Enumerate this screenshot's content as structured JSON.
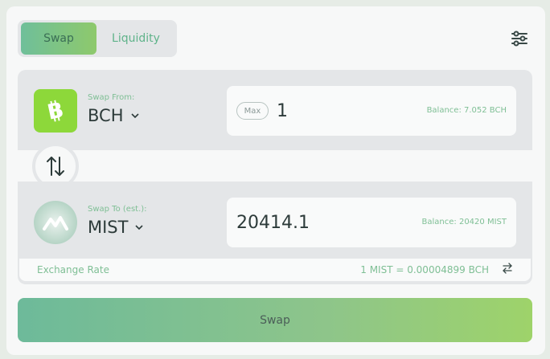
{
  "tabs": {
    "swap": "Swap",
    "liquidity": "Liquidity"
  },
  "from": {
    "label": "Swap From:",
    "token": "BCH",
    "amount": "1",
    "max_label": "Max",
    "balance": "Balance: 7.052 BCH"
  },
  "to": {
    "label": "Swap To (est.):",
    "token": "MIST",
    "amount": "20414.1",
    "balance": "Balance: 20420 MIST"
  },
  "exchange": {
    "label": "Exchange Rate",
    "value": "1 MIST = 0.00004899 BCH"
  },
  "swap_button": "Swap",
  "colors": {
    "accent_green": "#8dd83a",
    "text_green": "#7fbf95",
    "panel_bg": "#e4e6e8"
  }
}
